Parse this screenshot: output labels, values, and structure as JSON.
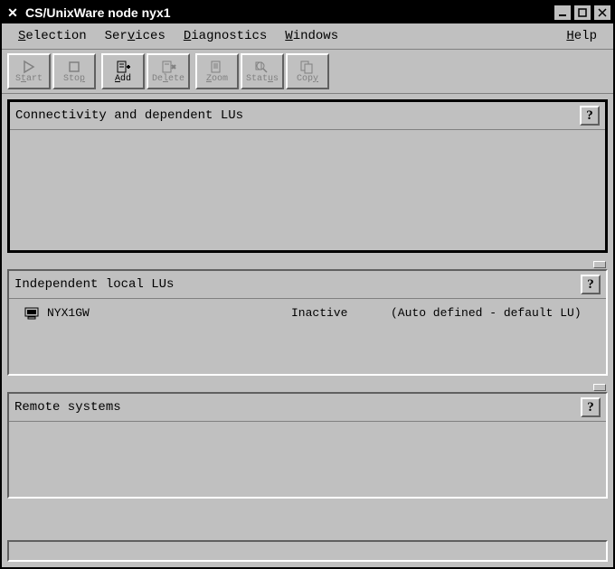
{
  "window": {
    "title": "CS/UnixWare node nyx1"
  },
  "menubar": {
    "selection": "Selection",
    "services": "Services",
    "diagnostics": "Diagnostics",
    "windows": "Windows",
    "help": "Help"
  },
  "toolbar": {
    "start": "Start",
    "stop": "Stop",
    "add": "Add",
    "delete": "Delete",
    "zoom": "Zoom",
    "status": "Status",
    "copy": "Copy"
  },
  "panels": {
    "connectivity": {
      "title": "Connectivity and dependent LUs"
    },
    "local_lus": {
      "title": "Independent local LUs",
      "items": [
        {
          "name": "NYX1GW",
          "status": "Inactive",
          "desc": "(Auto defined - default LU)"
        }
      ]
    },
    "remote": {
      "title": "Remote systems"
    }
  },
  "help_symbol": "?"
}
